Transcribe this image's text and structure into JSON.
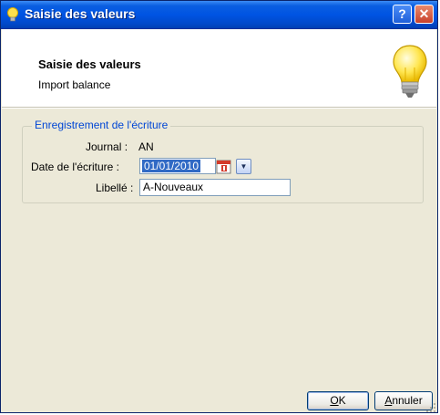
{
  "window": {
    "title": "Saisie des valeurs",
    "help_button": "?",
    "close_button": "✕"
  },
  "header": {
    "title": "Saisie des valeurs",
    "subtitle": "Import balance"
  },
  "group": {
    "legend": "Enregistrement de l'écriture",
    "journal_label": "Journal :",
    "journal_value": "AN",
    "date_label": "Date de l'écriture :",
    "date_value": "01/01/2010",
    "libelle_label": "Libellé :",
    "libelle_value": "A-Nouveaux"
  },
  "buttons": {
    "ok_key": "O",
    "ok_rest": "K",
    "cancel_key": "A",
    "cancel_rest": "nnuler"
  },
  "colors": {
    "titlebar": "#0054e3",
    "legend": "#0046d5",
    "selection": "#316ac5",
    "dialog_bg": "#ece9d8"
  }
}
